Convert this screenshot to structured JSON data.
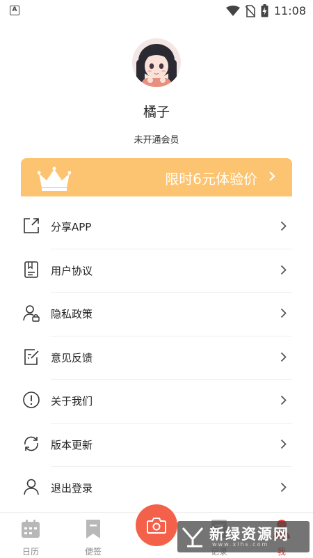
{
  "status_bar": {
    "time": "11:08",
    "left_badge": "A",
    "icons": [
      "wifi-icon",
      "no-sim-icon",
      "battery-charging-icon"
    ]
  },
  "profile": {
    "name": "橘子",
    "membership": "未开通会员"
  },
  "vip_banner": {
    "text": "限时6元体验价",
    "icon": "crown-icon",
    "color": "#fcc470"
  },
  "menu": {
    "items": [
      {
        "label": "分享APP",
        "icon": "share-icon"
      },
      {
        "label": "用户协议",
        "icon": "agreement-icon"
      },
      {
        "label": "隐私政策",
        "icon": "privacy-icon"
      },
      {
        "label": "意见反馈",
        "icon": "feedback-icon"
      },
      {
        "label": "关于我们",
        "icon": "info-icon"
      },
      {
        "label": "版本更新",
        "icon": "refresh-icon"
      },
      {
        "label": "退出登录",
        "icon": "user-logout-icon"
      }
    ]
  },
  "tabbar": {
    "tabs": [
      {
        "label": "日历",
        "icon": "calendar-icon",
        "active": false
      },
      {
        "label": "便签",
        "icon": "bookmark-icon",
        "active": false
      },
      {
        "label": "记录",
        "icon": "record-icon",
        "active": false
      },
      {
        "label": "我",
        "icon": "me-icon",
        "active": true
      }
    ],
    "camera_icon": "camera-icon",
    "accent": "#e8443b",
    "camera_color": "#f4614a"
  },
  "watermark": {
    "title": "新绿资源网",
    "url": "www.xlhs.com"
  }
}
